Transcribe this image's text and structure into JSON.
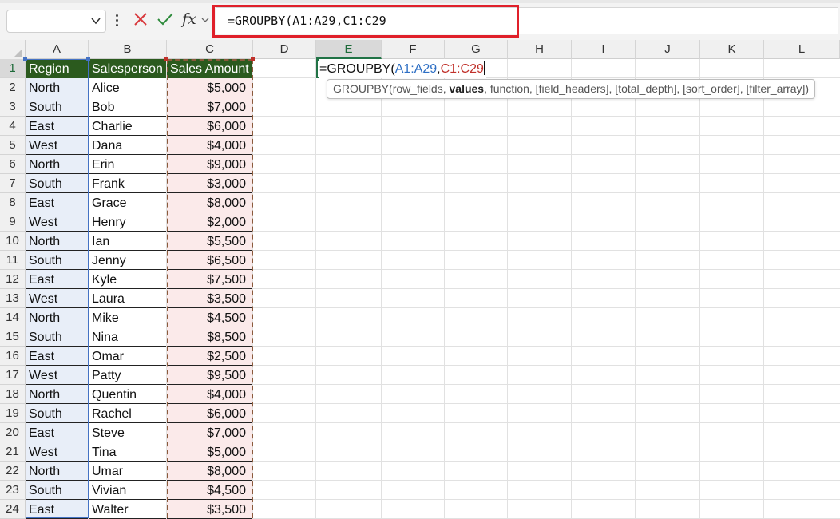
{
  "formula_bar": {
    "name_box_value": "",
    "cancel_icon": "x-icon",
    "enter_icon": "check-icon",
    "fx_label": "fx",
    "formula": "=GROUPBY(A1:A29,C1:C29"
  },
  "columns": [
    "A",
    "B",
    "C",
    "D",
    "E",
    "F",
    "G",
    "H",
    "I",
    "J",
    "K",
    "L"
  ],
  "active_column": "E",
  "rows": [
    "1",
    "2",
    "3",
    "4",
    "5",
    "6",
    "7",
    "8",
    "9",
    "10",
    "11",
    "12",
    "13",
    "14",
    "15",
    "16",
    "17",
    "18",
    "19",
    "20",
    "21",
    "22",
    "23",
    "24"
  ],
  "table": {
    "headers": [
      "Region",
      "Salesperson",
      "Sales Amount"
    ],
    "rows": [
      [
        "North",
        "Alice",
        "$5,000"
      ],
      [
        "South",
        "Bob",
        "$7,000"
      ],
      [
        "East",
        "Charlie",
        "$6,000"
      ],
      [
        "West",
        "Dana",
        "$4,000"
      ],
      [
        "North",
        "Erin",
        "$9,000"
      ],
      [
        "South",
        "Frank",
        "$3,000"
      ],
      [
        "East",
        "Grace",
        "$8,000"
      ],
      [
        "West",
        "Henry",
        "$2,000"
      ],
      [
        "North",
        "Ian",
        "$5,500"
      ],
      [
        "South",
        "Jenny",
        "$6,500"
      ],
      [
        "East",
        "Kyle",
        "$7,500"
      ],
      [
        "West",
        "Laura",
        "$3,500"
      ],
      [
        "North",
        "Mike",
        "$4,500"
      ],
      [
        "South",
        "Nina",
        "$8,500"
      ],
      [
        "East",
        "Omar",
        "$2,500"
      ],
      [
        "West",
        "Patty",
        "$9,500"
      ],
      [
        "North",
        "Quentin",
        "$4,000"
      ],
      [
        "South",
        "Rachel",
        "$6,000"
      ],
      [
        "East",
        "Steve",
        "$7,000"
      ],
      [
        "West",
        "Tina",
        "$5,000"
      ],
      [
        "North",
        "Umar",
        "$8,000"
      ],
      [
        "South",
        "Vivian",
        "$4,500"
      ],
      [
        "East",
        "Walter",
        "$3,500"
      ]
    ]
  },
  "cell_editor": {
    "prefix": "=GROUPBY(",
    "ref1": "A1:A29",
    "comma": ",",
    "ref2": "C1:C29"
  },
  "tooltip": {
    "fn": "GROUPBY(",
    "arg1": "row_fields, ",
    "current_arg": "values",
    "rest": ", function, [field_headers], [total_depth], [sort_order], [filter_array])"
  },
  "colors": {
    "header_fill": "#2b5a1e",
    "region_fill": "#e8eef8",
    "amount_fill": "#fbeaea",
    "highlight_border": "#e0202a",
    "ref1_color": "#2e6fc4",
    "ref2_color": "#c0302a",
    "accent": "#217346"
  }
}
